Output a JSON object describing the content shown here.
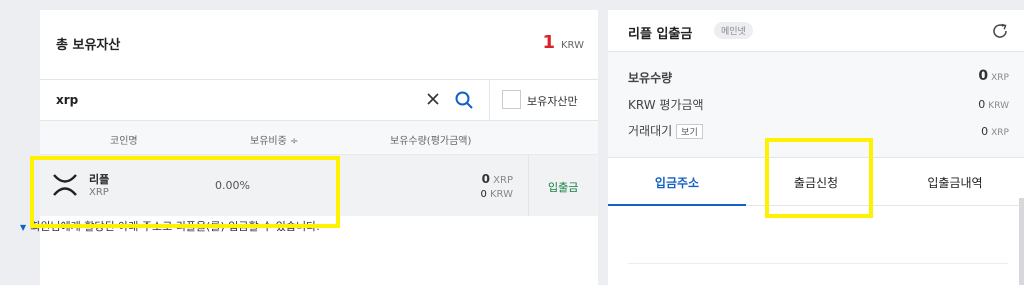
{
  "holdings": {
    "title": "총 보유자산",
    "total_value": "1",
    "total_unit": "KRW",
    "search_value": "xrp",
    "owned_only_label": "보유자산만",
    "columns": [
      "코인명",
      "보유비중 ÷",
      "보유수량(평가금액)"
    ],
    "row": {
      "name": "리플",
      "ticker": "XRP",
      "ratio": "0.00%",
      "qty_value": "0",
      "qty_unit": "XRP",
      "krw_value": "0",
      "krw_unit": "KRW",
      "action": "입출금"
    }
  },
  "deposit_panel": {
    "title": "리플 입출금",
    "network_badge": "메인넷",
    "labels": {
      "holding_qty": "보유수량",
      "krw_eval": "KRW 평가금액",
      "pending": "거래대기",
      "view_button": "보기"
    },
    "values": {
      "holding_qty": "0",
      "holding_unit": "XRP",
      "krw_eval": "0",
      "krw_unit": "KRW",
      "pending": "0",
      "pending_unit": "XRP"
    },
    "tabs": [
      "입금주소",
      "출금신청",
      "입출금내역"
    ],
    "notice": "회원님에게 할당된 아래 주소로 리플을(를) 입금할 수 있습니다."
  },
  "colors": {
    "accent_blue": "#1261c4",
    "red": "#d8232a",
    "green": "#148043",
    "highlight": "#fff200"
  }
}
